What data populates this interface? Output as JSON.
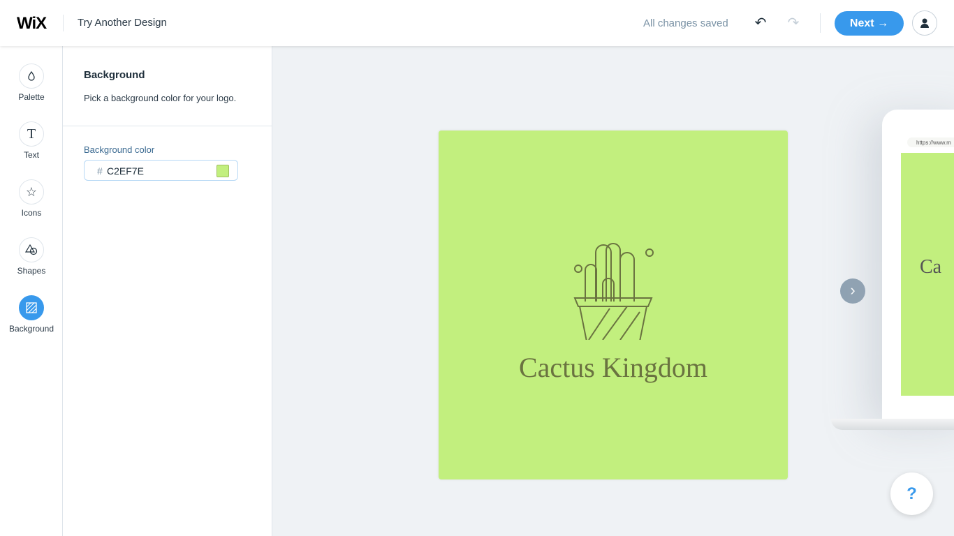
{
  "header": {
    "logo": "WiX",
    "title": "Try Another Design",
    "status": "All changes saved",
    "next_label": "Next",
    "next_arrow": "→"
  },
  "sidebar": {
    "items": [
      {
        "label": "Palette",
        "icon": "palette-icon"
      },
      {
        "label": "Text",
        "icon": "text-icon"
      },
      {
        "label": "Icons",
        "icon": "star-icon"
      },
      {
        "label": "Shapes",
        "icon": "shapes-icon"
      },
      {
        "label": "Background",
        "icon": "background-icon",
        "active": true
      }
    ]
  },
  "panel": {
    "heading": "Background",
    "description": "Pick a background color for your logo.",
    "field_label": "Background color",
    "hash": "#",
    "value": "C2EF7E"
  },
  "canvas": {
    "brand_name": "Cactus Kingdom",
    "bg_color": "#C2EF7E",
    "text_color": "#6A7340"
  },
  "preview": {
    "url": "https://www.m",
    "text": "Ca"
  },
  "help": {
    "label": "?"
  },
  "colors": {
    "accent": "#3899EC"
  }
}
